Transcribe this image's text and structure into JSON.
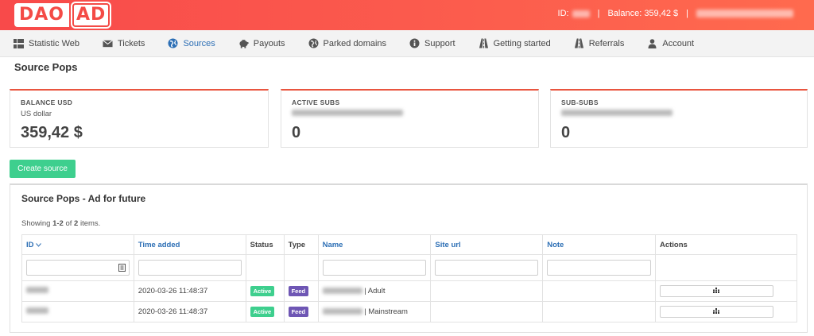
{
  "header": {
    "logo_left": "DAO",
    "logo_right": "AD",
    "id_label": "ID:",
    "balance_label": "Balance: 359,42 $",
    "separator": "|"
  },
  "nav": {
    "items": [
      {
        "label": "Statistic Web",
        "icon": "grid-icon"
      },
      {
        "label": "Tickets",
        "icon": "envelope-icon"
      },
      {
        "label": "Sources",
        "icon": "globe-icon"
      },
      {
        "label": "Payouts",
        "icon": "piggy-bank-icon"
      },
      {
        "label": "Parked domains",
        "icon": "globe-icon"
      },
      {
        "label": "Support",
        "icon": "info-icon"
      },
      {
        "label": "Getting started",
        "icon": "road-icon"
      },
      {
        "label": "Referrals",
        "icon": "road-icon"
      },
      {
        "label": "Account",
        "icon": "user-icon"
      }
    ],
    "active": "Sources"
  },
  "page": {
    "title": "Source Pops"
  },
  "cards": {
    "balance": {
      "label": "BALANCE USD",
      "sub": "US dollar",
      "value": "359,42 $"
    },
    "active_subs": {
      "label": "ACTIVE SUBS",
      "value": "0"
    },
    "sub_subs": {
      "label": "SUB-SUBS",
      "value": "0"
    }
  },
  "create_button": "Create source",
  "panel": {
    "title": "Source Pops - Ad for future",
    "summary_prefix": "Showing ",
    "summary_range": "1-2",
    "summary_mid": " of ",
    "summary_total": "2",
    "summary_suffix": " items."
  },
  "table": {
    "columns": {
      "id": "ID",
      "time": "Time added",
      "status": "Status",
      "type": "Type",
      "name": "Name",
      "site": "Site url",
      "note": "Note",
      "actions": "Actions"
    },
    "rows": [
      {
        "time": "2020-03-26 11:48:37",
        "status": "Active",
        "type": "Feed",
        "name_suffix": "| Adult"
      },
      {
        "time": "2020-03-26 11:48:37",
        "status": "Active",
        "type": "Feed",
        "name_suffix": "| Mainstream"
      }
    ]
  },
  "colors": {
    "accent": "#f44b46",
    "link": "#2d6fb5",
    "success": "#3ecf8e",
    "feed": "#6e56b4"
  }
}
